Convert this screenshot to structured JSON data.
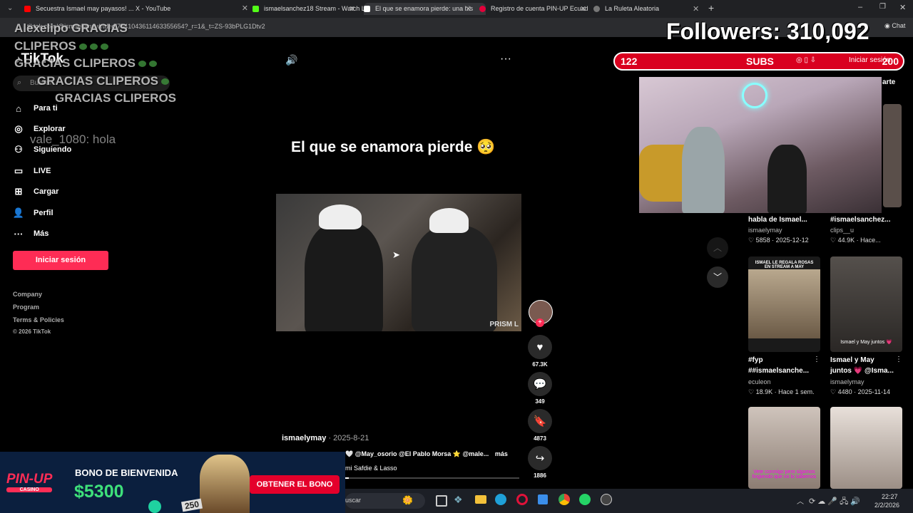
{
  "browser": {
    "tabs": [
      {
        "title": "Secuestra Ismael may payasos! ... X - YouTube",
        "color": "#ff0000"
      },
      {
        "title": "ismaelsanchez18 Stream - Watch L",
        "color": "#53fc18"
      },
      {
        "title": "El que se enamora pierde: una his",
        "color": "#ffffff"
      },
      {
        "title": "Registro de cuenta PIN-UP Ecuad",
        "color": "#e4003a"
      },
      {
        "title": "La Ruleta Aleatoria",
        "color": "#777777"
      }
    ],
    "url": "tiktok.com/@ismaelymay/video/7541043611463355654?_r=1&_t=ZS-93bPLG1Dtv2"
  },
  "stream_overlay": {
    "thanks_lines": [
      "Alexelipo GRACIAS",
      "CLIPEROS",
      "GRACIAS CLIPEROS",
      "GRACIAS CLIPEROS",
      "GRACIAS CLIPEROS"
    ],
    "chat_line": "vale_1080: hola",
    "followers": "Followers: 310,092",
    "subs_current": "122",
    "subs_label": "SUBS",
    "subs_goal": "200"
  },
  "sidebar": {
    "logo": "TikTok",
    "search_placeholder": "Buscar",
    "items": [
      {
        "label": "Para ti",
        "icon": "home-icon"
      },
      {
        "label": "Explorar",
        "icon": "compass-icon"
      },
      {
        "label": "Siguiendo",
        "icon": "following-icon"
      },
      {
        "label": "LIVE",
        "icon": "live-icon"
      },
      {
        "label": "Cargar",
        "icon": "upload-icon"
      },
      {
        "label": "Perfil",
        "icon": "profile-icon"
      },
      {
        "label": "Más",
        "icon": "more-icon"
      }
    ],
    "login_button": "Iniciar sesión",
    "footer": [
      "Company",
      "Program",
      "Terms & Policies",
      "© 2026 TikTok"
    ]
  },
  "video": {
    "caption": "El que se enamora pierde 🥺",
    "watermark": "PRISM L",
    "author": "ismaelymay",
    "date": "· 2025-8-21",
    "description": "🤍 @May_osorio @El Pablo Morsa ⭐ @male...",
    "more": "más",
    "music": "mi Safdie & Lasso",
    "likes": "67.3K",
    "comments": "349",
    "saves": "4873",
    "shares": "1886"
  },
  "header_right": {
    "login": "Iniciar sesión",
    "share_partial": "arte"
  },
  "related": [
    {
      "title": "habla de Ismael...",
      "author": "ismaelymay",
      "meta": "♡ 5858 · 2025-12-12"
    },
    {
      "title": "#ismaelsanchez...",
      "author": "clips__u",
      "meta": "♡ 44.9K · Hace..."
    },
    {
      "title": "#fyp",
      "title2": "##ismaelsanche...",
      "author": "eculeon",
      "meta": "♡ 18.9K · Hace 1 sem.",
      "thumb_text": "ISMAEL LE REGALA ROSAS EN STREAM A MAY"
    },
    {
      "title": "Ismael y May",
      "title2": "juntos 💗 @Isma...",
      "author": "ismaelymay",
      "meta": "♡ 4480 · 2025-11-14",
      "thumb_text": "Ismael y May juntos 💗"
    },
    {
      "thumb_text": "Vete conmigo pero sigamos fingiendo que no lo sabemos"
    },
    {
      "thumb_text": ""
    }
  ],
  "ad": {
    "brand": "PIN-UP",
    "brand_sub": "CASINO",
    "headline": "BONO DE BIENVENIDA",
    "amount": "$5300",
    "cta": "OBTENER EL BONO",
    "chip": "250"
  },
  "taskbar": {
    "search": "uscar",
    "time": "22:27",
    "date": "2/2/2026"
  }
}
